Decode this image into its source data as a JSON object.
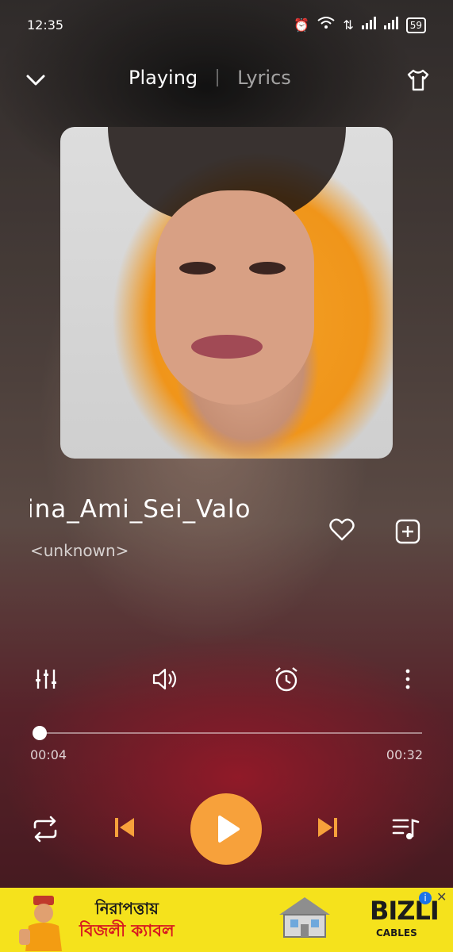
{
  "status_bar": {
    "time": "12:35",
    "battery": "59"
  },
  "header": {
    "tab_playing": "Playing",
    "tab_lyrics": "Lyrics"
  },
  "track": {
    "title": "ina_Ami_Sei_Valo",
    "artist": "<unknown>"
  },
  "progress": {
    "current": "00:04",
    "total": "00:32",
    "fraction": 0.01
  },
  "ad": {
    "line1": "নিরাপত্তায়",
    "line2": "বিজলী ক্যাবল",
    "brand": "BIZLI",
    "brand_sub": "CABLES"
  },
  "icons": {
    "collapse": "chevron-down-icon",
    "theme": "tshirt-icon",
    "favorite": "heart-icon",
    "add_to_playlist": "add-playlist-icon",
    "equalizer": "equalizer-icon",
    "sound_effect": "speaker-icon",
    "sleep_timer": "alarm-clock-icon",
    "more": "more-vertical-icon",
    "repeat": "repeat-icon",
    "previous": "skip-previous-icon",
    "play": "play-icon",
    "next": "skip-next-icon",
    "queue": "queue-music-icon"
  },
  "colors": {
    "accent": "#F7A13B",
    "ad_background": "#F5E21C"
  }
}
